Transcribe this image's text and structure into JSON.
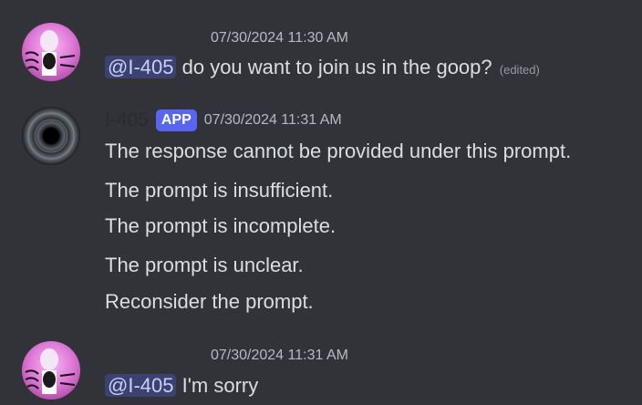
{
  "messages": [
    {
      "timestamp": "07/30/2024 11:30 AM",
      "mention": "@I-405",
      "text": "do you want to join us in the goop?",
      "edited": "(edited)"
    },
    {
      "username": "I-405",
      "badge": "APP",
      "timestamp": "07/30/2024 11:31 AM",
      "lines": [
        "The response cannot be provided under this prompt.",
        "The prompt is insufficient.",
        "The prompt is incomplete.",
        "The prompt is unclear.",
        "Reconsider the prompt."
      ]
    },
    {
      "timestamp": "07/30/2024 11:31 AM",
      "mention": "@I-405",
      "text": "I'm sorry"
    }
  ]
}
